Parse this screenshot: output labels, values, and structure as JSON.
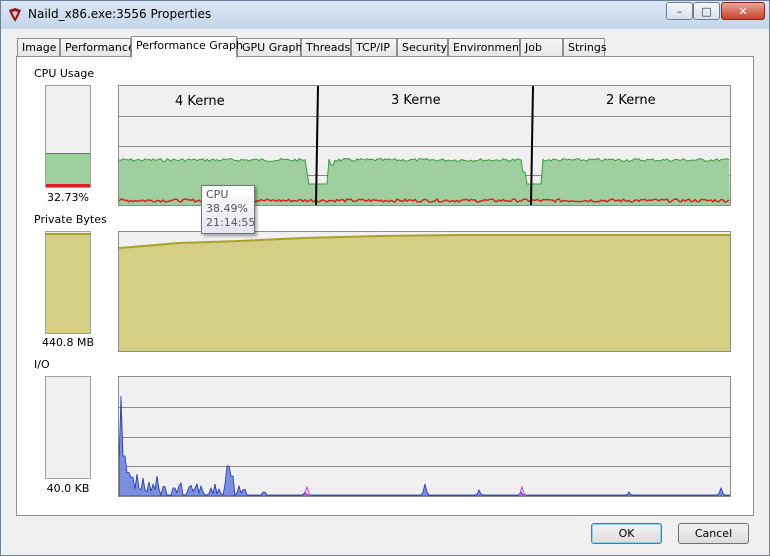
{
  "window": {
    "title": "Naild_x86.exe:3556 Properties",
    "minimize": "–",
    "maximize": "□",
    "close": "✕"
  },
  "tabs": [
    {
      "label": "Image"
    },
    {
      "label": "Performance"
    },
    {
      "label": "Performance Graph",
      "active": true
    },
    {
      "label": "GPU Graph"
    },
    {
      "label": "Threads"
    },
    {
      "label": "TCP/IP"
    },
    {
      "label": "Security"
    },
    {
      "label": "Environment"
    },
    {
      "label": "Job"
    },
    {
      "label": "Strings"
    }
  ],
  "cpu": {
    "label": "CPU Usage",
    "value": "32.73%",
    "level": 0.3273,
    "kernel_level": 0.02,
    "annotations": [
      "4 Kerne",
      "3 Kerne",
      "2 Kerne"
    ],
    "colors": {
      "user": "#9fce9f",
      "userLine": "#3c9a3c",
      "kernel": "#e02020"
    }
  },
  "tooltip": {
    "series": "CPU",
    "value": "38.49%",
    "time": "21:14:55"
  },
  "private_bytes": {
    "label": "Private Bytes",
    "value": "440.8 MB",
    "level": 0.97,
    "colors": {
      "fill": "#d4cf84",
      "line": "#a8a02c"
    }
  },
  "io": {
    "label": "I/O",
    "value": "40.0  KB",
    "colors": {
      "read": "#7b8fe0",
      "readLine": "#2233aa",
      "other": "#d040d0"
    }
  },
  "buttons": {
    "ok": "OK",
    "cancel": "Cancel"
  }
}
